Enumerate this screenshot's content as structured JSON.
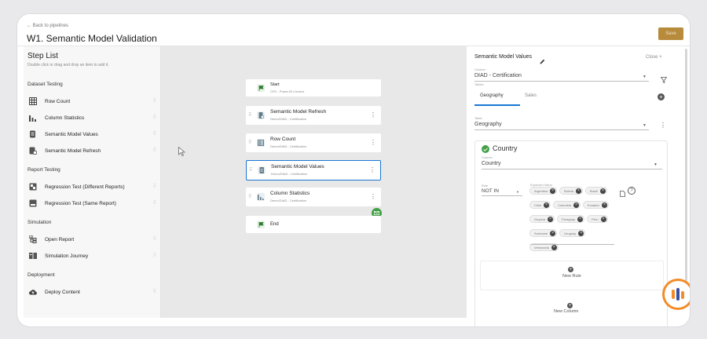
{
  "header": {
    "back_link": "← Back to pipelines",
    "title": "W1. Semantic Model Validation",
    "save_label": "Save"
  },
  "left_panel": {
    "title": "Step List",
    "subtitle": "Double click or drag and drop an item to add it.",
    "sections": {
      "dataset_testing": "Dataset Testing",
      "report_testing": "Report Testing",
      "simulation": "Simulation",
      "deployment": "Deployment"
    },
    "items": {
      "row_count": "Row Count",
      "column_statistics": "Column Statistics",
      "semantic_model_values": "Semantic Model Values",
      "semantic_model_refresh": "Semantic Model Refresh",
      "regression_diff": "Regression Test (Different Reports)",
      "regression_same": "Regression Test (Same Report)",
      "open_report": "Open Report",
      "simulation_journey": "Simulation Journey",
      "deploy_content": "Deploy Content"
    }
  },
  "canvas": {
    "start": {
      "title": "Start",
      "sub": "CFD - Power BI Context"
    },
    "smr": {
      "title": "Semantic Model Refresh",
      "sub": "Demo/DIAD - Certification"
    },
    "rc": {
      "title": "Row Count",
      "sub": "Demo/DIAD - Certification"
    },
    "smv": {
      "title": "Semantic Model Values",
      "sub": "Demo/DIAD - Certification"
    },
    "cs": {
      "title": "Column Statistics",
      "sub": "Demo/DIAD - Certification"
    },
    "end": {
      "title": "End"
    }
  },
  "details": {
    "title": "Semantic Model Values",
    "close_label": "Close ×",
    "context_label": "Context",
    "context_value": "DIAD - Certification",
    "tables_label": "Tables",
    "tab_geography": "Geography",
    "tab_sales": "Sales",
    "table_label": "Table",
    "table_value": "Geography",
    "column_card_title": "Country",
    "column_label": "Column",
    "column_value": "Country",
    "rule_label": "Rule",
    "rule_value": "NOT IN",
    "expected_label": "Expected Value",
    "chips": [
      "Argentina",
      "Bolivia",
      "Brazil",
      "Chile",
      "Colombia",
      "Ecuador",
      "Guyana",
      "Paraguay",
      "Peru",
      "Suriname",
      "Uruguay",
      "Venezuela"
    ],
    "new_rule_label": "New Rule",
    "new_column_label": "New Column"
  },
  "colors": {
    "accent": "#1976d2",
    "save": "#b88a3c",
    "success": "#43a047"
  }
}
